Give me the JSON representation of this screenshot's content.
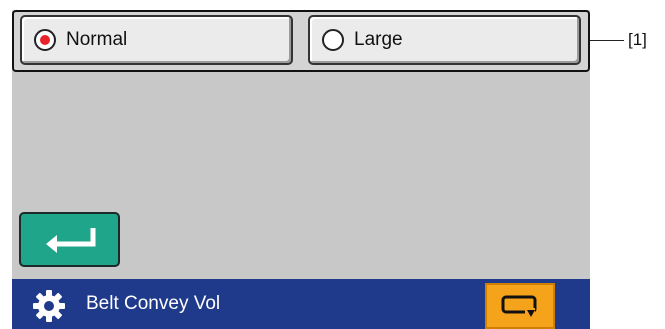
{
  "options": {
    "normal_label": "Normal",
    "large_label": "Large",
    "selected": "Normal"
  },
  "callout": {
    "label": "[1]"
  },
  "status_bar": {
    "title": "Belt Convey Vol"
  },
  "colors": {
    "screen_bg": "#c8c8c8",
    "status_bar": "#1f3a8a",
    "enter_button": "#1fa58a",
    "loop_button": "#f5a31a",
    "radio_selected": "#e8232a"
  },
  "icons": {
    "enter": "enter-arrow-icon",
    "settings": "gear-icon",
    "loop": "loop-arrow-icon"
  }
}
